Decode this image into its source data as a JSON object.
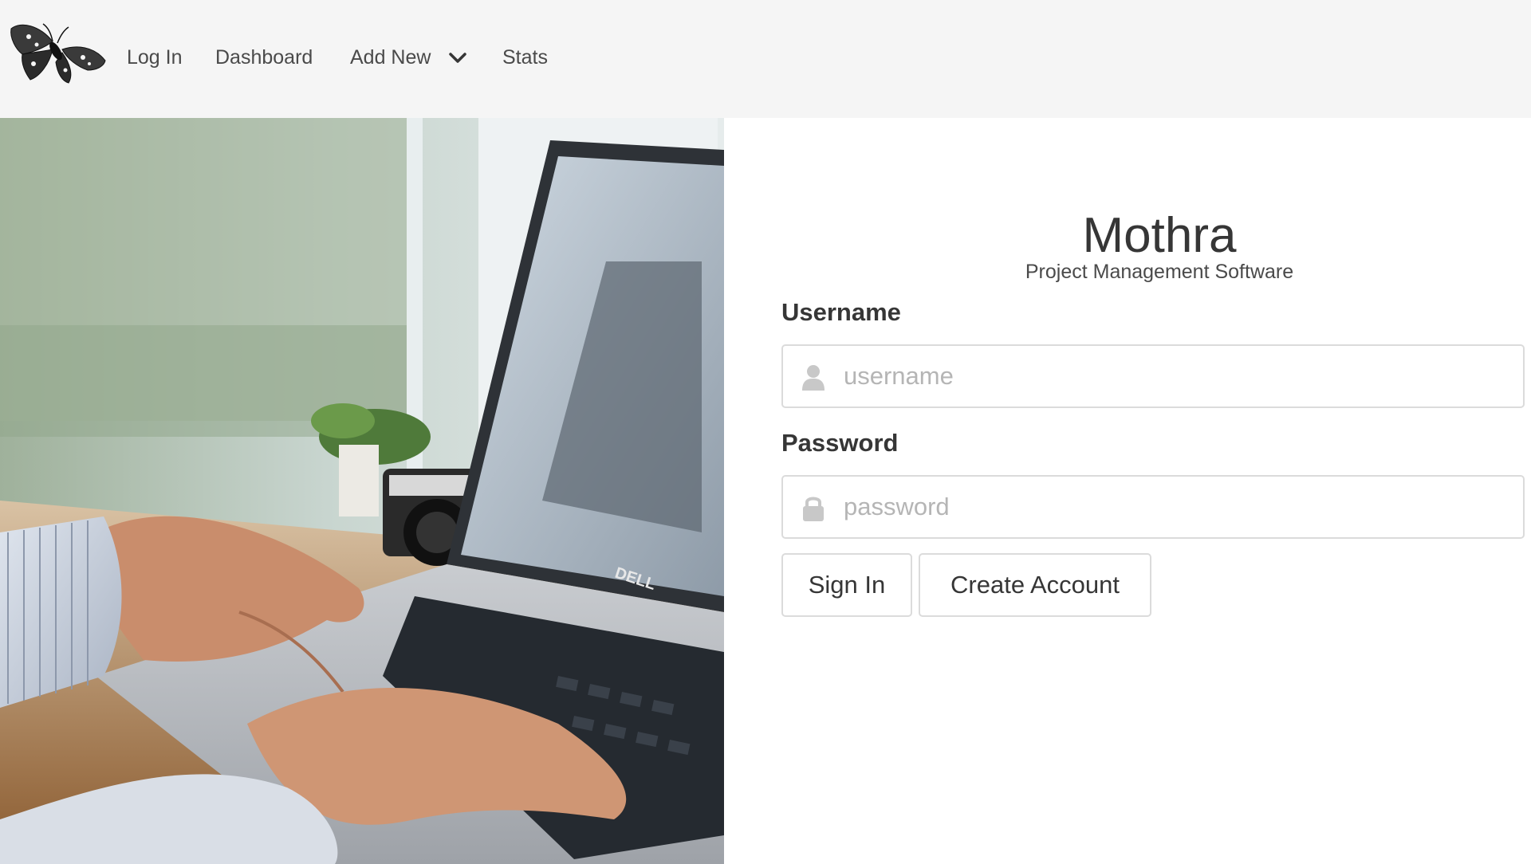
{
  "navbar": {
    "logo_icon": "moth-icon",
    "items": [
      {
        "label": "Log In"
      },
      {
        "label": "Dashboard"
      },
      {
        "label": "Add New",
        "icon": "chevron-down-icon"
      },
      {
        "label": "Stats"
      }
    ],
    "background": "#f5f5f5"
  },
  "hero": {
    "laptop_brand": "DELL"
  },
  "login": {
    "title": "Mothra",
    "subtitle": "Project Management Software",
    "username_label": "Username",
    "username_placeholder": "username",
    "username_value": "",
    "username_icon": "user-icon",
    "password_label": "Password",
    "password_placeholder": "password",
    "password_value": "",
    "password_icon": "lock-icon",
    "signin_label": "Sign In",
    "create_label": "Create Account"
  },
  "colors": {
    "text": "#363636",
    "border": "#dbdbdb",
    "placeholder": "#b5b5b5"
  }
}
